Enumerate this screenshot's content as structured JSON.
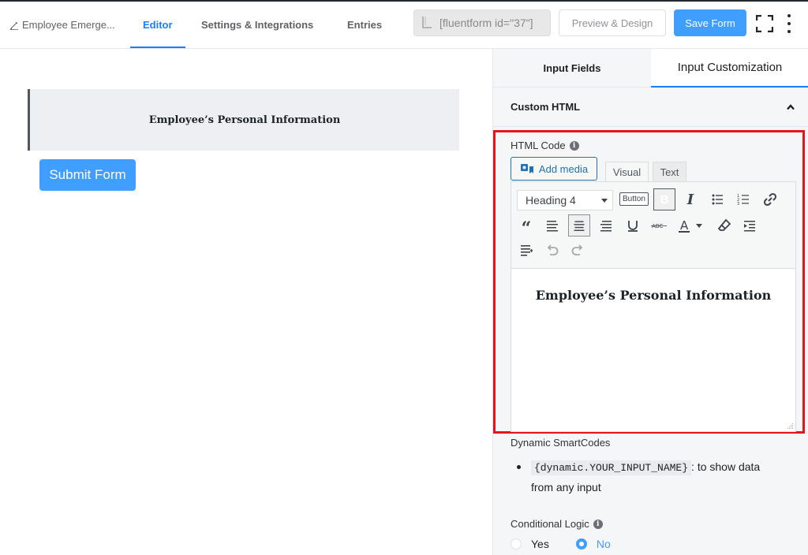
{
  "header": {
    "form_name": "Employee Emerge...",
    "tabs": [
      {
        "label": "Editor",
        "active": true
      },
      {
        "label": "Settings & Integrations",
        "active": false
      },
      {
        "label": "Entries",
        "active": false
      }
    ],
    "shortcode": "[fluentform id=\"37\"]",
    "preview_label": "Preview & Design",
    "save_label": "Save Form",
    "accent_color": "#1a7efb"
  },
  "canvas": {
    "html_block_text": "Employee’s Personal Information",
    "submit_label": "Submit Form"
  },
  "sidebar": {
    "tabs": [
      {
        "label": "Input Fields",
        "active": false
      },
      {
        "label": "Input Customization",
        "active": true
      }
    ],
    "section_title": "Custom HTML",
    "html_code_label": "HTML Code",
    "add_media_label": "Add media",
    "mode_tabs": {
      "visual": "Visual",
      "text": "Text"
    },
    "toolbar": {
      "format_select": "Heading 4",
      "button_label": "Button",
      "bold_label": "B"
    },
    "editor_content": "Employee’s Personal Information",
    "smartcodes_label": "Dynamic SmartCodes",
    "smartcode_item": {
      "code": "{dynamic.YOUR_INPUT_NAME}",
      "description": ": to show data from any input"
    },
    "conditional_logic_label": "Conditional Logic",
    "conditional_options": [
      {
        "label": "Yes",
        "selected": false
      },
      {
        "label": "No",
        "selected": true
      }
    ],
    "highlight_color": "#e5161b"
  }
}
